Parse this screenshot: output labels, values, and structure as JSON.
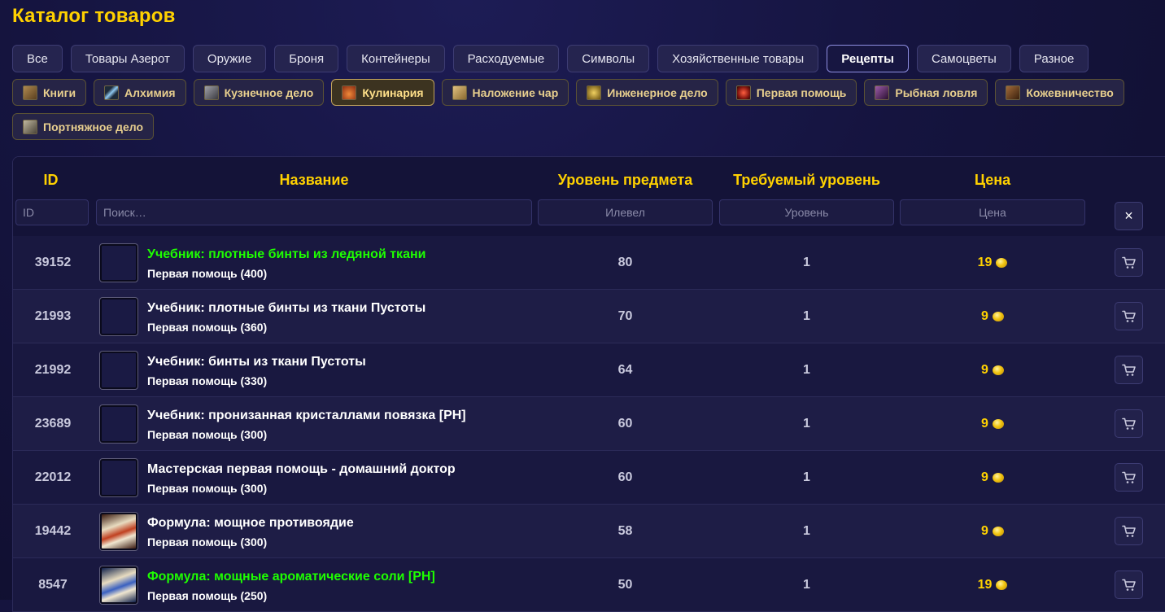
{
  "page": {
    "title": "Каталог товаров"
  },
  "categories": [
    {
      "label": "Все",
      "active": false
    },
    {
      "label": "Товары Азерот",
      "active": false
    },
    {
      "label": "Оружие",
      "active": false
    },
    {
      "label": "Броня",
      "active": false
    },
    {
      "label": "Контейнеры",
      "active": false
    },
    {
      "label": "Расходуемые",
      "active": false
    },
    {
      "label": "Символы",
      "active": false
    },
    {
      "label": "Хозяйственные товары",
      "active": false
    },
    {
      "label": "Рецепты",
      "active": true
    },
    {
      "label": "Самоцветы",
      "active": false
    },
    {
      "label": "Разное",
      "active": false
    }
  ],
  "subcategories": [
    {
      "label": "Книги",
      "icon": "book-icon",
      "color": "#8a6a3a",
      "active": false
    },
    {
      "label": "Алхимия",
      "icon": "alchemy-icon",
      "color": "#6fa0c8",
      "active": false
    },
    {
      "label": "Кузнечное дело",
      "icon": "anvil-icon",
      "color": "#7a7a80",
      "active": false
    },
    {
      "label": "Кулинария",
      "icon": "cooking-icon",
      "color": "#d0602a",
      "active": true
    },
    {
      "label": "Наложение чар",
      "icon": "enchanting-icon",
      "color": "#c89a50",
      "active": false
    },
    {
      "label": "Инженерное дело",
      "icon": "engineering-icon",
      "color": "#c8a030",
      "active": false
    },
    {
      "label": "Первая помощь",
      "icon": "first-aid-icon",
      "color": "#b83020",
      "active": false
    },
    {
      "label": "Рыбная ловля",
      "icon": "fishing-icon",
      "color": "#6a3a7a",
      "active": false
    },
    {
      "label": "Кожевничество",
      "icon": "leatherworking-icon",
      "color": "#7a4a2a",
      "active": false
    },
    {
      "label": "Портняжное дело",
      "icon": "tailoring-icon",
      "color": "#8a8070",
      "active": false
    }
  ],
  "table": {
    "headers": {
      "id": "ID",
      "name": "Название",
      "item_level": "Уровень предмета",
      "required_level": "Требуемый уровень",
      "price": "Цена"
    },
    "filters": {
      "id_placeholder": "ID",
      "name_placeholder": "Поиск…",
      "item_level_placeholder": "Илевел",
      "required_level_placeholder": "Уровень",
      "price_placeholder": "Цена"
    },
    "clear_button": "×",
    "rows": [
      {
        "id": "39152",
        "name": "Учебник: плотные бинты из ледяной ткани",
        "subtitle": "Первая помощь (400)",
        "item_level": "80",
        "required_level": "1",
        "price": "19",
        "quality": "uncommon",
        "icon": "empty-slot-icon"
      },
      {
        "id": "21993",
        "name": "Учебник: плотные бинты из ткани Пустоты",
        "subtitle": "Первая помощь (360)",
        "item_level": "70",
        "required_level": "1",
        "price": "9",
        "quality": "common",
        "icon": "empty-slot-icon"
      },
      {
        "id": "21992",
        "name": "Учебник: бинты из ткани Пустоты",
        "subtitle": "Первая помощь (330)",
        "item_level": "64",
        "required_level": "1",
        "price": "9",
        "quality": "common",
        "icon": "empty-slot-icon"
      },
      {
        "id": "23689",
        "name": "Учебник: пронизанная кристаллами повязка [PH]",
        "subtitle": "Первая помощь (300)",
        "item_level": "60",
        "required_level": "1",
        "price": "9",
        "quality": "common",
        "icon": "empty-slot-icon"
      },
      {
        "id": "22012",
        "name": "Мастерская первая помощь - домашний доктор",
        "subtitle": "Первая помощь (300)",
        "item_level": "60",
        "required_level": "1",
        "price": "9",
        "quality": "common",
        "icon": "empty-slot-icon"
      },
      {
        "id": "19442",
        "name": "Формула: мощное противоядие",
        "subtitle": "Первая помощь (300)",
        "item_level": "58",
        "required_level": "1",
        "price": "9",
        "quality": "common",
        "icon": "recipe-scroll-icon"
      },
      {
        "id": "8547",
        "name": "Формула: мощные ароматические соли [PH]",
        "subtitle": "Первая помощь (250)",
        "item_level": "50",
        "required_level": "1",
        "price": "19",
        "quality": "uncommon",
        "icon": "recipe-scroll-blue-icon"
      }
    ]
  },
  "colors": {
    "accent_gold": "#ffd100",
    "uncommon_green": "#1eff00",
    "background": "#15143f"
  }
}
